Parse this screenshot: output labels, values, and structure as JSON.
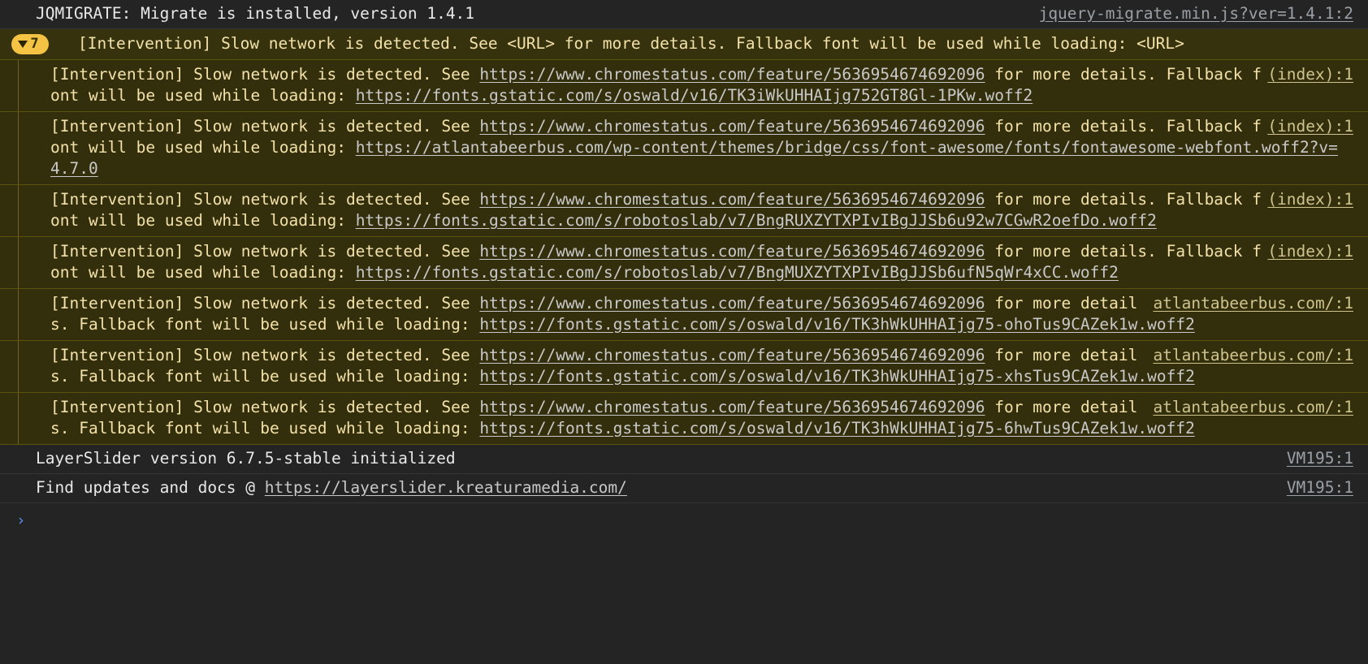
{
  "app": {
    "name": "chrome-devtools-console",
    "theme": "dark",
    "colors": {
      "background": "#242424",
      "warning_background": "#36320d",
      "warning_group_background": "#332f0c",
      "warning_text": "#f3e1a9",
      "warning_border": "#5c530f",
      "badge_background": "#f5c344",
      "link": "#c9c9c9",
      "prompt_caret": "#5c8dea",
      "row_border": "#343434"
    }
  },
  "rows": [
    {
      "type": "info",
      "message": "JQMIGRATE: Migrate is installed, version 1.4.1",
      "source": "jquery-migrate.min.js?ver=1.4.1:2"
    }
  ],
  "group": {
    "expanded": true,
    "count": "7",
    "triangle": "down-triangle-icon",
    "summary": "[Intervention] Slow network is detected. See <URL> for more details. Fallback font will be used while loading: <URL>",
    "entries": [
      {
        "prefix": "[Intervention] Slow network is detected. See ",
        "link1": "https://www.chromestatus.com/feature/5636954674692096",
        "middle": " for more details. Fallback font will be used while loading: ",
        "link2": "https://fonts.gstatic.com/s/oswald/v16/TK3iWkUHHAIjg752GT8Gl-1PKw.woff2",
        "source": "(index):1"
      },
      {
        "prefix": "[Intervention] Slow network is detected. See ",
        "link1": "https://www.chromestatus.com/feature/5636954674692096",
        "middle": " for more details. Fallback font will be used while loading: ",
        "link2": "https://atlantabeerbus.com/wp-content/themes/bridge/css/font-awesome/fonts/fontawesome-webfont.woff2?v=4.7.0",
        "source": "(index):1"
      },
      {
        "prefix": "[Intervention] Slow network is detected. See ",
        "link1": "https://www.chromestatus.com/feature/5636954674692096",
        "middle": " for more details. Fallback font will be used while loading: ",
        "link2": "https://fonts.gstatic.com/s/robotoslab/v7/BngRUXZYTXPIvIBgJJSb6u92w7CGwR2oefDo.woff2",
        "source": "(index):1"
      },
      {
        "prefix": "[Intervention] Slow network is detected. See ",
        "link1": "https://www.chromestatus.com/feature/5636954674692096",
        "middle": " for more details. Fallback font will be used while loading: ",
        "link2": "https://fonts.gstatic.com/s/robotoslab/v7/BngMUXZYTXPIvIBgJJSb6ufN5qWr4xCC.woff2",
        "source": "(index):1"
      },
      {
        "prefix": "[Intervention] Slow network is detected. See ",
        "link1": "https://www.chromestatus.com/feature/5636954674692096",
        "middle": " for more details. Fallback font will be used while loading: ",
        "link2": "https://fonts.gstatic.com/s/oswald/v16/TK3hWkUHHAIjg75-ohoTus9CAZek1w.woff2",
        "source": "atlantabeerbus.com/:1"
      },
      {
        "prefix": "[Intervention] Slow network is detected. See ",
        "link1": "https://www.chromestatus.com/feature/5636954674692096",
        "middle": " for more details. Fallback font will be used while loading: ",
        "link2": "https://fonts.gstatic.com/s/oswald/v16/TK3hWkUHHAIjg75-xhsTus9CAZek1w.woff2",
        "source": "atlantabeerbus.com/:1"
      },
      {
        "prefix": "[Intervention] Slow network is detected. See ",
        "link1": "https://www.chromestatus.com/feature/5636954674692096",
        "middle": " for more details. Fallback font will be used while loading: ",
        "link2": "https://fonts.gstatic.com/s/oswald/v16/TK3hWkUHHAIjg75-6hwTus9CAZek1w.woff2",
        "source": "atlantabeerbus.com/:1"
      }
    ]
  },
  "footer_rows": [
    {
      "type": "info",
      "message": "LayerSlider version 6.7.5-stable initialized",
      "source": "VM195:1"
    },
    {
      "type": "info-link",
      "prefix": "Find updates and docs @ ",
      "link": "https://layerslider.kreaturamedia.com/",
      "source": "VM195:1"
    }
  ],
  "prompt": {
    "caret": "›",
    "value": "",
    "placeholder": ""
  }
}
